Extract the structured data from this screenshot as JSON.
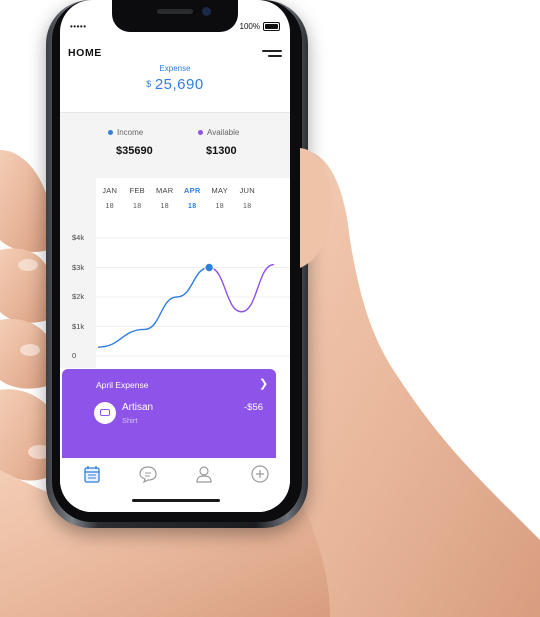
{
  "status_bar": {
    "signal": "•••••",
    "battery_percent": "100%"
  },
  "header": {
    "title": "HOME"
  },
  "expense": {
    "label": "Expense",
    "currency": "$",
    "amount": "25,690"
  },
  "summary": {
    "income": {
      "label": "Income",
      "value": "$35690",
      "color": "#2f7fe0"
    },
    "available": {
      "label": "Available",
      "value": "$1300",
      "color": "#8e53e8"
    }
  },
  "months": [
    {
      "name": "JAN",
      "day": "18"
    },
    {
      "name": "FEB",
      "day": "18"
    },
    {
      "name": "MAR",
      "day": "18"
    },
    {
      "name": "APR",
      "day": "18"
    },
    {
      "name": "MAY",
      "day": "18"
    },
    {
      "name": "JUN",
      "day": "18"
    }
  ],
  "selected_month": "APR",
  "chart_data": {
    "type": "line",
    "x": [
      "JAN",
      "FEB",
      "MAR",
      "APR",
      "MAY",
      "JUN"
    ],
    "y_ticks": [
      "0",
      "$1k",
      "$2k",
      "$3k",
      "$4k"
    ],
    "ylim": [
      0,
      4000
    ],
    "series": [
      {
        "values": [
          300,
          900,
          2000,
          3000,
          1500,
          3100
        ],
        "colors": [
          "#2f7fe0",
          "#8e53e8"
        ]
      }
    ],
    "highlight_index": 3
  },
  "card": {
    "title": "April Expense",
    "item_name": "Artisan",
    "item_sub": "Shirt",
    "item_amount": "-$56",
    "background": "#8e53e8"
  },
  "tabs": [
    {
      "icon": "calendar-icon",
      "active": true
    },
    {
      "icon": "chat-icon",
      "active": false
    },
    {
      "icon": "user-icon",
      "active": false
    },
    {
      "icon": "plus-circle-icon",
      "active": false
    }
  ],
  "colors": {
    "accent": "#2f7fe0",
    "purple": "#8e53e8"
  }
}
